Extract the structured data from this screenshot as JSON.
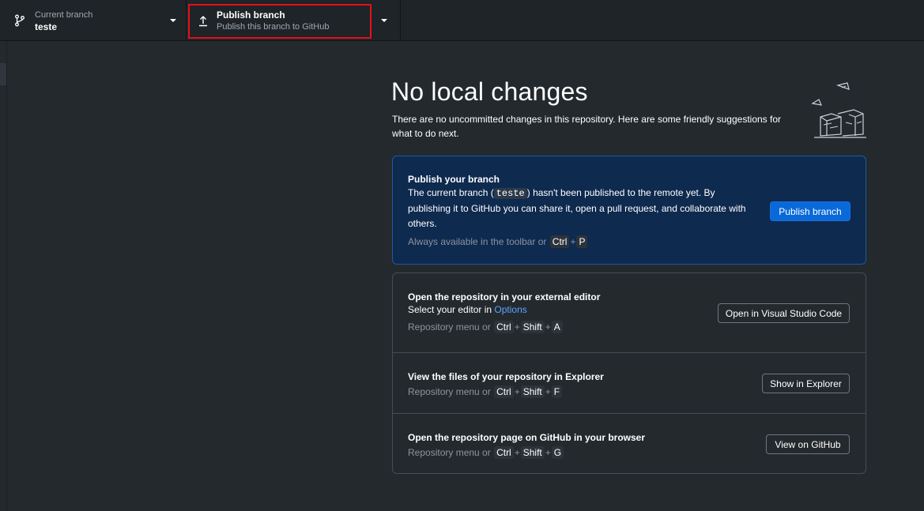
{
  "toolbar": {
    "branch": {
      "label": "Current branch",
      "value": "teste"
    },
    "publish": {
      "title": "Publish branch",
      "subtitle": "Publish this branch to GitHub"
    }
  },
  "main": {
    "title": "No local changes",
    "subtitle": "There are no uncommitted changes in this repository. Here are some friendly suggestions for what to do next."
  },
  "publish_card": {
    "title": "Publish your branch",
    "body_before": "The current branch (",
    "branch_name": "teste",
    "body_after": ") hasn't been published to the remote yet. By publishing it to GitHub you can share it, open a pull request, and collaborate with others.",
    "hint_prefix": "Always available in the toolbar or",
    "keys": [
      "Ctrl",
      "P"
    ],
    "button": "Publish branch"
  },
  "suggestions": [
    {
      "title": "Open the repository in your external editor",
      "desc_prefix": "Select your editor in ",
      "desc_link": "Options",
      "hint_prefix": "Repository menu or",
      "keys": [
        "Ctrl",
        "Shift",
        "A"
      ],
      "button": "Open in Visual Studio Code"
    },
    {
      "title": "View the files of your repository in Explorer",
      "hint_prefix": "Repository menu or",
      "keys": [
        "Ctrl",
        "Shift",
        "F"
      ],
      "button": "Show in Explorer"
    },
    {
      "title": "Open the repository page on GitHub in your browser",
      "hint_prefix": "Repository menu or",
      "keys": [
        "Ctrl",
        "Shift",
        "G"
      ],
      "button": "View on GitHub"
    }
  ],
  "plus": "+",
  "colors": {
    "accent": "#0969da",
    "highlight": "#e3111b",
    "publish_card_bg": "#0e2a4f"
  }
}
